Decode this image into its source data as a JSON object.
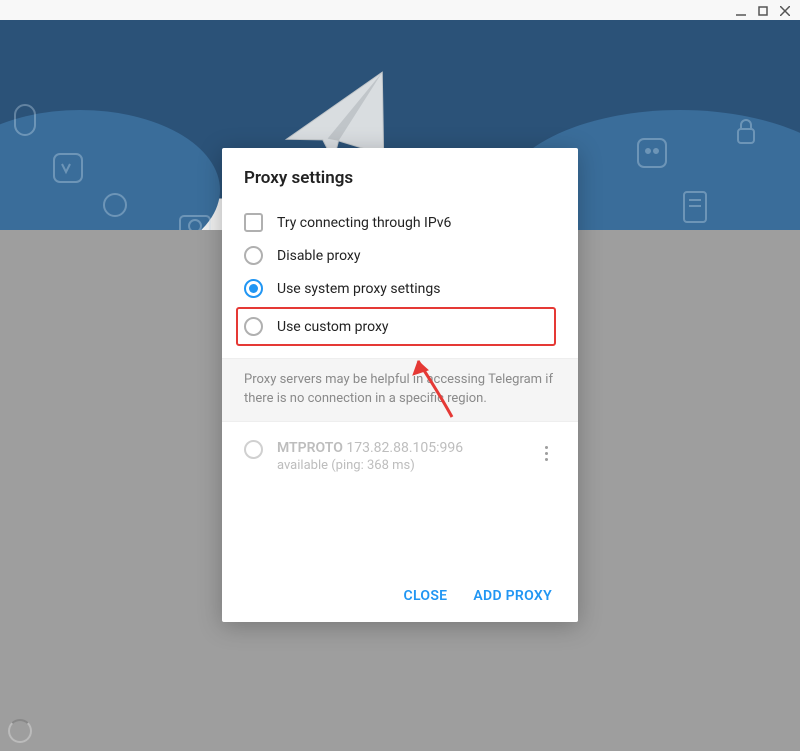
{
  "dialog": {
    "title": "Proxy settings",
    "options": {
      "ipv6_label": "Try connecting through IPv6",
      "disable_label": "Disable proxy",
      "system_label": "Use system proxy settings",
      "custom_label": "Use custom proxy"
    },
    "hint": "Proxy servers may be helpful in accessing Telegram if there is no connection in a specific region.",
    "proxies": [
      {
        "name": "MTPROTO",
        "address": "173.82.88.105:996",
        "status": "available (ping: 368 ms)"
      }
    ],
    "actions": {
      "close_label": "CLOSE",
      "add_label": "ADD PROXY"
    }
  }
}
